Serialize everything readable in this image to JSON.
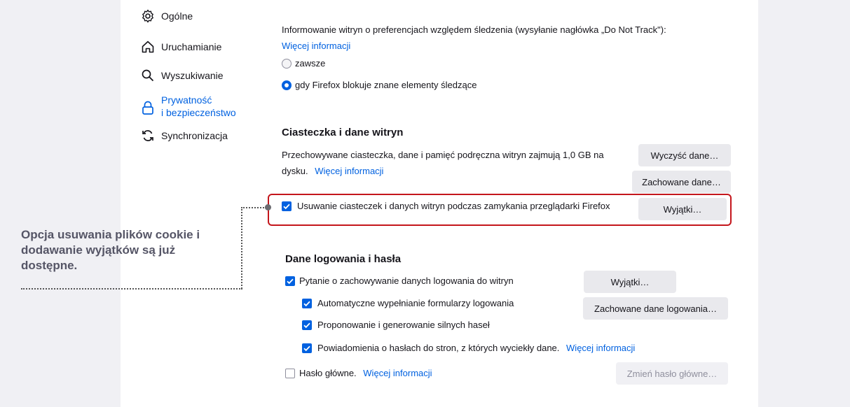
{
  "sidebar": {
    "items": [
      {
        "label": "Ogólne",
        "icon": "gear-icon"
      },
      {
        "label": "Uruchamianie",
        "icon": "home-icon"
      },
      {
        "label": "Wyszukiwanie",
        "icon": "search-icon"
      },
      {
        "label_line1": "Prywatność",
        "label_line2": "i bezpieczeństwo",
        "icon": "lock-icon",
        "active": true
      },
      {
        "label": "Synchronizacja",
        "icon": "sync-icon"
      }
    ]
  },
  "dnt": {
    "text": "Informowanie witryn o preferencjach względem śledzenia (wysyłanie nagłówka „Do Not Track\"):",
    "more_info": "Więcej informacji",
    "option_always": "zawsze",
    "option_blocking": "gdy Firefox blokuje znane elementy śledzące",
    "selected": "option_blocking"
  },
  "cookies": {
    "heading": "Ciasteczka i dane witryn",
    "desc_line1": "Przechowywane ciasteczka, dane i pamięć podręczna witryn zajmują 1,0 GB na",
    "desc_line2": "dysku.",
    "more_info": "Więcej informacji",
    "clear_button": "Wyczyść dane…",
    "manage_button": "Zachowane dane…",
    "delete_on_close": "Usuwanie ciasteczek i danych witryn podczas zamykania przeglądarki Firefox",
    "delete_on_close_checked": true,
    "exceptions_button": "Wyjątki…"
  },
  "logins": {
    "heading": "Dane logowania i hasła",
    "ask_save": "Pytanie o zachowywanie danych logowania do witryn",
    "autofill": "Automatyczne wypełnianie formularzy logowania",
    "suggest": "Proponowanie i generowanie silnych haseł",
    "breach": "Powiadomienia o hasłach do stron, z których wyciekły dane.",
    "breach_more_info": "Więcej informacji",
    "master": "Hasło główne.",
    "master_more_info": "Więcej informacji",
    "exceptions_button": "Wyjątki…",
    "saved_logins_button": "Zachowane dane logowania…",
    "change_master_button": "Zmień hasło główne…"
  },
  "annotation": {
    "text": "Opcja usuwania plików cookie i dodawanie wyjątków są już dostępne."
  },
  "colors": {
    "accent": "#0061e0",
    "highlight_border": "#c4161c",
    "annotation_text": "#555566"
  }
}
